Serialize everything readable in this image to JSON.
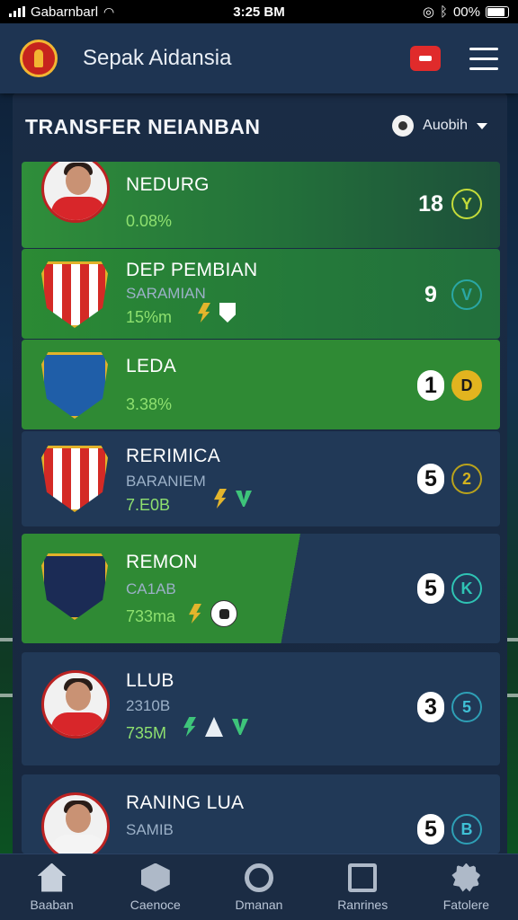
{
  "status_bar": {
    "carrier": "Gabarnbarl",
    "time": "3:25 BM",
    "battery": "00%"
  },
  "header": {
    "title": "Sepak Aidansia"
  },
  "section": {
    "title": "TRANSFER NEIANBAN",
    "sort_label": "Auobih"
  },
  "cards": [
    {
      "name": "NEDURG",
      "sub": "",
      "value": "0.08%",
      "score": "18",
      "badge": "Y",
      "badge_color": "#c4dc3a"
    },
    {
      "name": "DEP PEMBIAN",
      "sub": "SARAMIAN",
      "value": "15%m",
      "score": "9",
      "badge": "V",
      "badge_color": "#2aa7a4"
    },
    {
      "name": "LEDA",
      "sub": "",
      "value": "3.38%",
      "score": "1",
      "badge": "D",
      "badge_color": "#e2b41f"
    },
    {
      "name": "RERIMICA",
      "sub": "BARANIEM",
      "value": "7.E0B",
      "score": "5",
      "badge": "2",
      "badge_color": "#b9a21c"
    },
    {
      "name": "REMON",
      "sub": "CA1AB",
      "value": "733ma",
      "score": "5",
      "badge": "K",
      "badge_color": "#2fc3b4"
    },
    {
      "name": "LLUB",
      "sub": "2310B",
      "value": "735M",
      "score": "3",
      "badge": "5",
      "badge_color": "#2e9fb5"
    },
    {
      "name": "RANING LUA",
      "sub": "SAMIB",
      "value": "",
      "score": "5",
      "badge": "B",
      "badge_color": "#2e9fb5"
    }
  ],
  "bottom_nav": [
    {
      "label": "Baaban",
      "icon": "home-icon"
    },
    {
      "label": "Caenoce",
      "icon": "box-icon"
    },
    {
      "label": "Dmanan",
      "icon": "compass-icon"
    },
    {
      "label": "Ranrines",
      "icon": "square-icon"
    },
    {
      "label": "Fatolere",
      "icon": "gear-icon"
    }
  ],
  "colors": {
    "header": "#1e3452",
    "card_green": "#2b8a34",
    "card_dark": "#1f3552",
    "accent_red": "#e02b2b"
  }
}
